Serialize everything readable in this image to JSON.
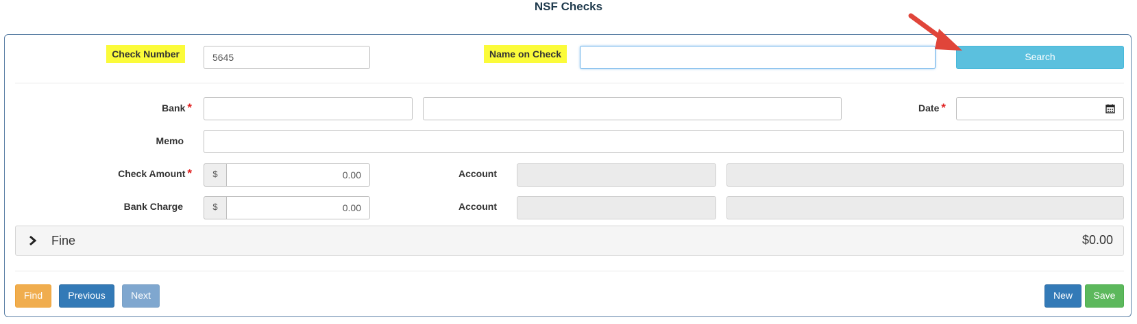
{
  "page": {
    "title": "NSF Checks"
  },
  "search_row": {
    "check_number_label": "Check Number",
    "check_number_value": "5645",
    "name_on_check_label": "Name on Check",
    "name_on_check_value": "",
    "search_label": "Search"
  },
  "form": {
    "bank_label": "Bank",
    "date_label": "Date",
    "memo_label": "Memo",
    "check_amount_label": "Check Amount",
    "check_amount_value": "0.00",
    "bank_charge_label": "Bank Charge",
    "bank_charge_value": "0.00",
    "currency_symbol": "$",
    "account_label_1": "Account",
    "account_label_2": "Account",
    "required_mark": "*"
  },
  "fine": {
    "label": "Fine",
    "amount": "$0.00"
  },
  "footer": {
    "find_label": "Find",
    "previous_label": "Previous",
    "next_label": "Next",
    "new_label": "New",
    "save_label": "Save"
  },
  "colors": {
    "highlight": "#fbfb3a",
    "search_button": "#5bc0de",
    "find_button": "#f0ad4e",
    "primary_button": "#337ab7",
    "save_button": "#5cb85c",
    "required": "#e02020",
    "annotation_arrow": "#e0453a"
  },
  "icons": {
    "calendar": "calendar-icon",
    "chevron": "chevron-right-icon",
    "arrow": "annotation-arrow-icon"
  }
}
